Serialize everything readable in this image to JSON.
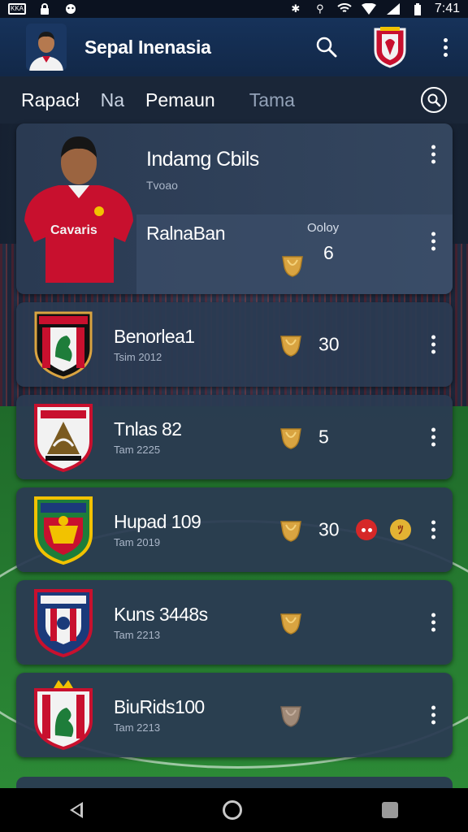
{
  "status_bar": {
    "time": "7:41",
    "left_badge": "KKA"
  },
  "app_bar": {
    "title": "Sepal Inenasia"
  },
  "tabs": [
    {
      "label": "Rapacł"
    },
    {
      "label": "Na"
    },
    {
      "label": "Pemaun"
    },
    {
      "label": "Tama"
    }
  ],
  "featured": {
    "title": "Indamg Cbils",
    "subtitle": "Tvoao",
    "player_name": "RalnaBan",
    "shirt_text": "Cavaris",
    "stat_label": "Ooloy",
    "count": "6"
  },
  "teams": [
    {
      "name": "Benorlea1",
      "sub": "Tsim 2012",
      "count": "30",
      "crest_colors": [
        "#c8102e",
        "#1e7d3a",
        "#111111"
      ]
    },
    {
      "name": "Tnlas 82",
      "sub": "Tam 2225",
      "count": "5",
      "crest_colors": [
        "#c8102e",
        "#ffffff",
        "#7a5a20"
      ]
    },
    {
      "name": "Hupad 109",
      "sub": "Tam 2019",
      "count": "30",
      "crest_colors": [
        "#1e7d3a",
        "#f2c200",
        "#c8102e"
      ],
      "extra_badges": true,
      "gold_badge_text": "ﾂ"
    },
    {
      "name": "Kuns 3448s",
      "sub": "Tam 2213",
      "count": "",
      "crest_colors": [
        "#1b3a7a",
        "#c8102e",
        "#ffffff"
      ]
    },
    {
      "name": "BiuRids100",
      "sub": "Tam 2213",
      "count": "",
      "crest_colors": [
        "#c8102e",
        "#1e7d3a",
        "#f2c200"
      ],
      "trophy_muted": true
    }
  ],
  "colors": {
    "app_bar": "#16325a",
    "card": "#2b3a52",
    "trophy": "#d9a441",
    "trophy_muted": "#a08a78",
    "badge_red": "#d62828",
    "badge_gold": "#e3b333"
  },
  "icons": {
    "search": "search-icon",
    "menu": "more-vert-icon",
    "trophy": "trophy-icon",
    "back": "back-icon",
    "home": "home-icon",
    "recents": "recents-icon"
  }
}
